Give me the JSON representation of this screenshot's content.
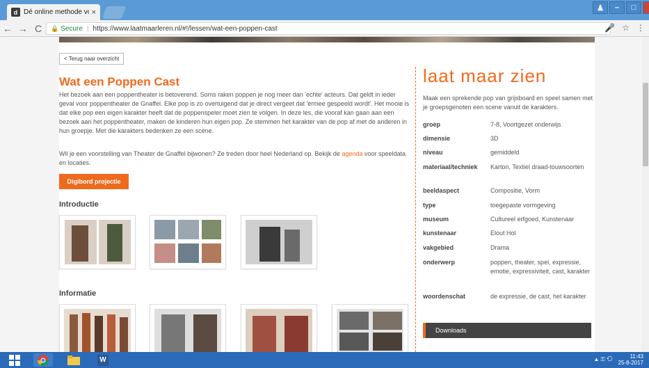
{
  "browser": {
    "tab_title": "Dé online methode voo",
    "tab_close": "×",
    "secure_label": "Secure",
    "separator": "|",
    "url": "https://www.laatmaarleren.nl/#!/lessen/wat-een-poppen-cast",
    "nav": {
      "back": "←",
      "forward": "→",
      "reload": "C"
    },
    "window_controls": {
      "user": "♟",
      "minimize": "–",
      "maximize": "□",
      "close": "x"
    },
    "right_icons": {
      "mic": "🎤",
      "star": "☆",
      "menu": "⋮"
    }
  },
  "page": {
    "back_link": "< Terug naar overzicht",
    "title": "Wat een Poppen Cast",
    "intro": "Het bezoek aan een poppentheater is betoverend. Soms raken poppen je nog meer dan 'echte' acteurs. Dat geldt in ieder geval voor poppentheater de Gnaffel. Elke pop is zo overtuigend dat je direct vergeet dat 'ermee gespeeld wordt'. Het mooie is dat elke pop een eigen karakter heeft dat de poppenspeler moet zien te volgen. In deze les, die vooraf kan gaan aan een bezoek aan het poppentheater, maken de kinderen hun eigen pop. Ze stemmen het karakter van de pop af met de anderen in hun groepje. Met die karakters bedenken ze een scène.",
    "intro2_before": "Wil je een voorstelling van Theater de Gnaffel bijwonen? Ze treden door heel Nederland op. Bekijk de",
    "intro2_link": "agenda",
    "intro2_after": "voor speeldata en locaties.",
    "digibord_button": "Digibord projectie",
    "sections": {
      "introductie": "Introductie",
      "informatie": "Informatie"
    }
  },
  "sidebar": {
    "logo": "laat maar zien",
    "tagline": "Maak een sprekende pop van grijsboard en speel samen met je groepsgenoten een scene vanuit de karakters.",
    "meta": [
      {
        "key": "groep",
        "value": "7-8, Voortgezet onderwijs"
      },
      {
        "key": "dimensie",
        "value": "3D"
      },
      {
        "key": "niveau",
        "value": "gemiddeld"
      },
      {
        "key": "materiaal/techniek",
        "value": "Karton, Textiel draad-touwsoorten"
      },
      {
        "key": "beeldaspect",
        "value": "Compositie, Vorm"
      },
      {
        "key": "type",
        "value": "toegepaste vormgeving"
      },
      {
        "key": "museum",
        "value": "Cultureel erfgoed, Kunstenaar"
      },
      {
        "key": "kunstenaar",
        "value": "Elout Hol"
      },
      {
        "key": "vakgebied",
        "value": "Drama"
      },
      {
        "key": "onderwerp",
        "value": "poppen, theater, spel, expressie, emotie, expressiviteit, cast, karakter"
      },
      {
        "key": "woordenschat",
        "value": "de expressie, de cast, het karakter"
      }
    ],
    "downloads": "Downloads"
  },
  "scroll_top": "⌃",
  "taskbar": {
    "word_icon": "W",
    "time": "11:43",
    "date": "25-8-2017",
    "tray_icons": "▲ ⚿ ⟲"
  },
  "colors": {
    "accent": "#f06a1d",
    "tabbar": "#5b9bd5",
    "taskbar": "#2a6ab8"
  }
}
